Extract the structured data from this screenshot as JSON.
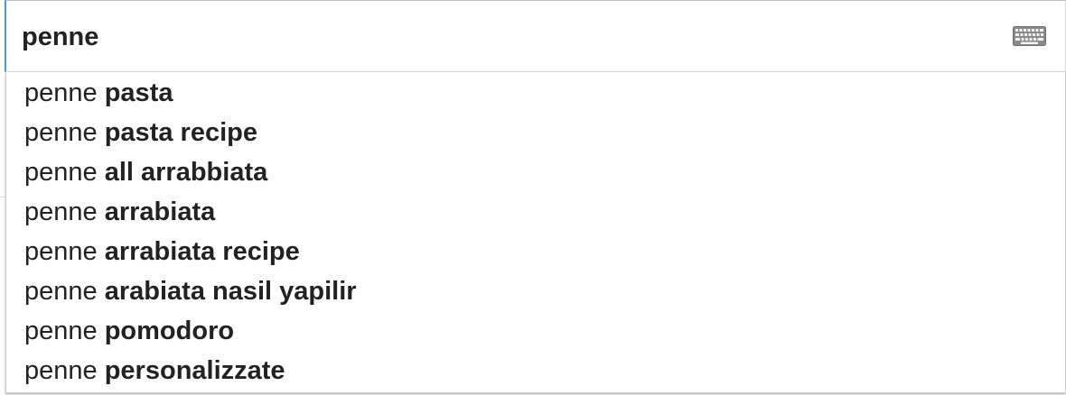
{
  "search": {
    "value": "penne",
    "keyboard_icon": "keyboard-icon"
  },
  "suggestions": [
    {
      "prefix": "penne",
      "completion": "pasta"
    },
    {
      "prefix": "penne",
      "completion": "pasta recipe"
    },
    {
      "prefix": "penne",
      "completion": "all arrabbiata"
    },
    {
      "prefix": "penne",
      "completion": "arrabiata"
    },
    {
      "prefix": "penne",
      "completion": "arrabiata recipe"
    },
    {
      "prefix": "penne",
      "completion": "arabiata nasil yapilir"
    },
    {
      "prefix": "penne",
      "completion": "pomodoro"
    },
    {
      "prefix": "penne",
      "completion": "personalizzate"
    }
  ],
  "colors": {
    "focus_border": "#4d90fe",
    "text": "#222222",
    "border": "#cccccc"
  }
}
